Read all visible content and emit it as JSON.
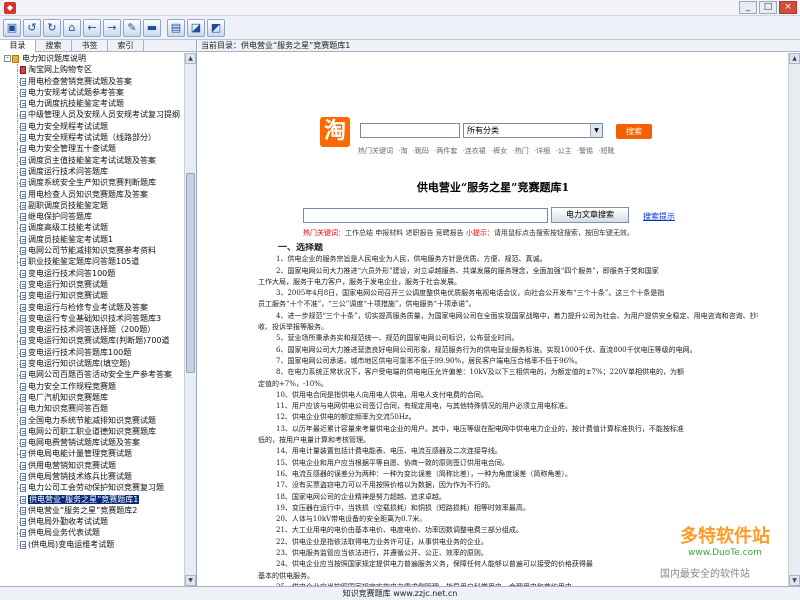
{
  "window": {
    "title": "",
    "buttons": [
      "_",
      "□",
      "×"
    ]
  },
  "toolbar": {
    "icons": [
      "home-icon",
      "back-icon",
      "refresh-icon",
      "home2-icon",
      "forward-left-icon",
      "forward-right-icon",
      "find-icon",
      "print-icon",
      "tile-icon",
      "settings-icon",
      "help-icon"
    ]
  },
  "left": {
    "tabs": [
      "目录",
      "搜索",
      "书签",
      "索引"
    ],
    "root": "电力知识题库说明",
    "items": [
      "淘宝网上购物专区",
      "用电检查营销竞赛试题及答案",
      "电力安规考试试题参考答案",
      "电力调度抗技能鉴定考试题",
      "中级管理人员及安规人员安规考试复习提纲",
      "电力安全规程考试试题",
      "电力安全规程考试试题（线路部分）",
      "电力安全管理五十查试题",
      "调度员主值技能鉴定考试试题及答案",
      "调度运行技术问答题库",
      "调度系统安全生产知识竞赛判断题库",
      "用电检查人员知识竞赛题库及答案",
      "副职调度员技能鉴定题",
      "继电保护问答题库",
      "调度高级工技能考试题",
      "调度员技能鉴定考试题1",
      "电网公司节能减排知识竞赛参考资料",
      "职业技能鉴定题库问答题105道",
      "变电运行技术问答100题",
      "变电运行知识竞赛试题",
      "变电运行知识竞赛试题",
      "变电运行与检修专业考试题及答案",
      "变电运行专业基础知识技术问答题库3",
      "变电运行技术问答选择题（200题）",
      "变电运行知识竞赛试题库(判断题)700道",
      "变电运行技术问答题库100题",
      "变电运行知识试题库(填空题)",
      "电网公司百题百答活动安全生产参考答案",
      "电力安全工作规程竞赛题",
      "电厂汽机知识竞赛题库",
      "电力知识竞赛问答百题",
      "全国电力系统节能减排知识竞赛试题",
      "电网公司职工职业道德知识竞赛题库",
      "电网电费营销试题库试题及答案",
      "供电局电能计量管理竞赛试题",
      "供用电营销知识竞赛试题",
      "供电局营销技术练兵比赛试题",
      "电力公司工会劳动保护知识竞赛复习题",
      "供电营业“服务之星”竞赛题库1",
      "供电营业“服务之星”竞赛题库2",
      "供电局外勤收考试试题",
      "供电局业务代表试题",
      "(供电局)变电运维考试题"
    ],
    "selected_index": 38
  },
  "address": {
    "label": "当前目录：",
    "value": "供电营业“服务之星”竞赛题库1"
  },
  "taobao": {
    "logo": "淘",
    "category": "所有分类",
    "button": "搜索",
    "hot": "热门关键词 ·淘 ·靴码 ·两件套 ·连衣裙 ·裤女 ·热门 ·详细 ·公主 ·警惕 ·短靴"
  },
  "document": {
    "title": "供电营业“服务之星”竞赛题库1",
    "search_button": "电力文章搜索",
    "search_tip": "搜索提示",
    "hot_label": "热门关键词：",
    "hot_words": "工作总结  申报材料  述职报告  竞聘报告",
    "tip_label": "小提示：",
    "tip_text": "请用鼠标点击搜索按钮搜索，按回车键无效。",
    "section": "一、选择题",
    "lines": [
      "1、供电企业的服务宗旨是人民电业为人民，供电服务方针是优质、方便、规范、真诚。",
      "2、国家电网公司大力推进“六员外形”建设，对立卓越服务、共谋发展的服务理念，全面加强“四个服务”，即服务于党和国家",
      "工作大局，服务于电力客户，服务于发电企业，服务于社会发展。",
      "3、2005年4月8日，国家电网公司召开三公调度整供电优质服务电视电话会议，向社会公开发布“三个十条”。这三个十条是指",
      "员工服务“十个不准”，“三公”调度“十项措施”，供电服务“十项承诺”。",
      "4、进一步规范“三个十条”，切实提高服务质量，为国家电网公司在全面实现国家战略中，着力提升公司为社会、为用户提供安全稳定、用电咨询和咨询、抄核",
      "收、投诉举报等服务。",
      "5、营业场所秉承务实和规范统一、规范的国家电网公司标识，公布营业时间。",
      "6、国家电网公司大力推进营造良好电网公司形象，规范服务行为的供电营业服务标准。实现1000千伏、直流800千伏电压等级的电网。",
      "7、国家电网公司承诺，城市地区供电可靠率不低于99.90%，居民客户端电压合格率不低于96%。",
      "8、在电力系统正常状况下，客户受电端的供电电压允许偏差：10kV及以下三相供电的，为额定值的±7%；220V单相供电的，为额",
      "定值的+7%，-10%。",
      "10、供用电合同是指供电人向用电人供电，用电人支付电费的合同。",
      "11、用户应该与电网供电公司签订合同，有规定用电，与其他特殊情况的用户必须立用电标准。",
      "12、供电企业供电的额定频率为交流50Hz。",
      "13、以历年最近累计容量来考量供电企业的用户。其中，电压等级在配电网中供电电力企业的，按计费值计算标准执行，不能按标准",
      "低的，按用户电量计算和考核管理。",
      "14、用电计量装置包括计费电能表、电压、电流互感器及二次连接导线。",
      "15、供电企业和用户应当根据平等自愿、协商一致的原则签订供用电合同。",
      "16、电流互感器的误差分为两种：一种为变比误差（简称比差），一种为角度误差（简称角差）。",
      "17、没有买票盗窃电力可以不用按照价格以为数据，因为作为不行的。",
      "18、国家电网公司的企业精神是努力超越、追求卓越。",
      "19、变压器在运行中，当铁损（空载损耗）和铜损（短路损耗）相等时效率最高。",
      "20、人体与10kV带电设备的安全距离为0.7米。",
      "21、大工业用电的电价由基本电价、电度电价、功率因数调整电费三部分组成。",
      "22、供电企业是指依法取得电力业务许可证，从事供电业务的企业。",
      "23、供电服务监管应当依法进行，并遵循公开、公正、效率的原则。",
      "24、供电企业应当按照国家规定提供电力普遍服务义务，保障任何人能够以普遍可以接受的价格获得最",
      "基本的供电服务。",
      "25、供电企业应当按照国家规定实施电力需求侧管理，指导用户科学用电、合理用电和节约用电。"
    ]
  },
  "status": {
    "text": "知识竞赛题库 www.zzjc.net.cn"
  },
  "watermark": {
    "brand": "多特软件站",
    "url": "www.DuoTe.com",
    "slogan": "国内最安全的软件站"
  }
}
